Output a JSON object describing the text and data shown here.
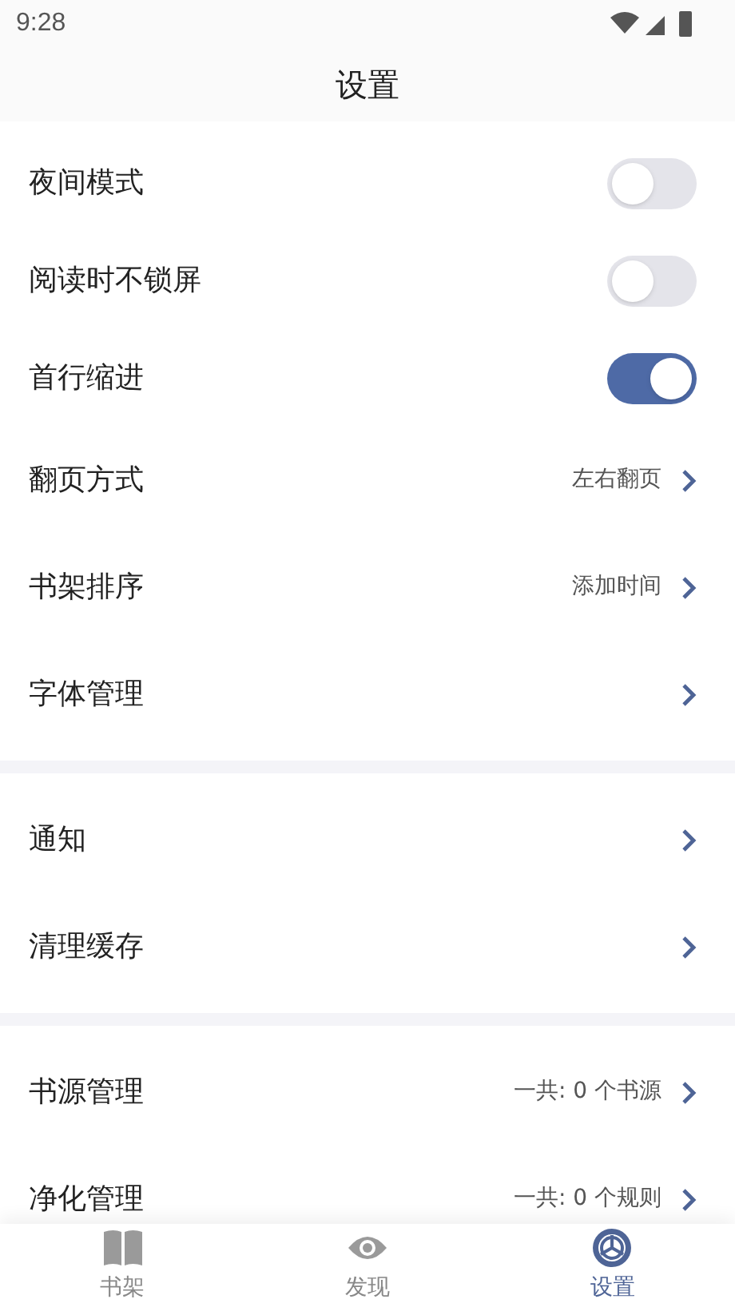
{
  "status_bar": {
    "time": "9:28"
  },
  "title": "设置",
  "sections": [
    {
      "items": [
        {
          "kind": "toggle",
          "label": "夜间模式",
          "on": false
        },
        {
          "kind": "toggle",
          "label": "阅读时不锁屏",
          "on": false
        },
        {
          "kind": "toggle",
          "label": "首行缩进",
          "on": true
        },
        {
          "kind": "link",
          "label": "翻页方式",
          "value": "左右翻页"
        },
        {
          "kind": "link",
          "label": "书架排序",
          "value": "添加时间"
        },
        {
          "kind": "link",
          "label": "字体管理"
        }
      ]
    },
    {
      "items": [
        {
          "kind": "link",
          "label": "通知"
        },
        {
          "kind": "link",
          "label": "清理缓存"
        }
      ]
    },
    {
      "items": [
        {
          "kind": "link",
          "label": "书源管理",
          "value": "一共: 0 个书源"
        },
        {
          "kind": "link",
          "label": "净化管理",
          "value": "一共: 0 个规则"
        }
      ]
    }
  ],
  "bottom_nav": [
    {
      "kind": "book",
      "label": "书架",
      "selected": false
    },
    {
      "kind": "eye",
      "label": "发现",
      "selected": false
    },
    {
      "kind": "gear",
      "label": "设置",
      "selected": true
    }
  ]
}
